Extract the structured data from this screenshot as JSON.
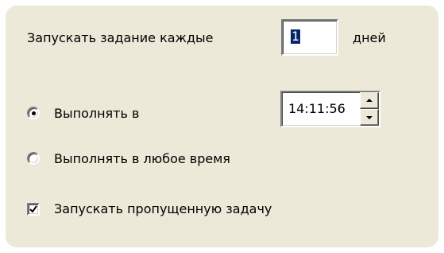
{
  "schedule": {
    "repeat_prefix": "Запускать задание каждые",
    "repeat_days_value": "1",
    "repeat_suffix": "дней"
  },
  "run_at": {
    "label": "Выполнять в",
    "selected": true,
    "time_value": "14:11:56"
  },
  "run_anytime": {
    "label": "Выполнять в любое время",
    "selected": false
  },
  "missed_task": {
    "label": "Запускать пропущенную задачу",
    "checked": true
  },
  "icons": {
    "spin_up": "arrow-up-icon",
    "spin_down": "arrow-down-icon",
    "check": "checkmark-icon"
  },
  "colors": {
    "panel_bg": "#ece9d8",
    "selection_bg": "#0a246a",
    "selection_fg": "#ffffff"
  }
}
